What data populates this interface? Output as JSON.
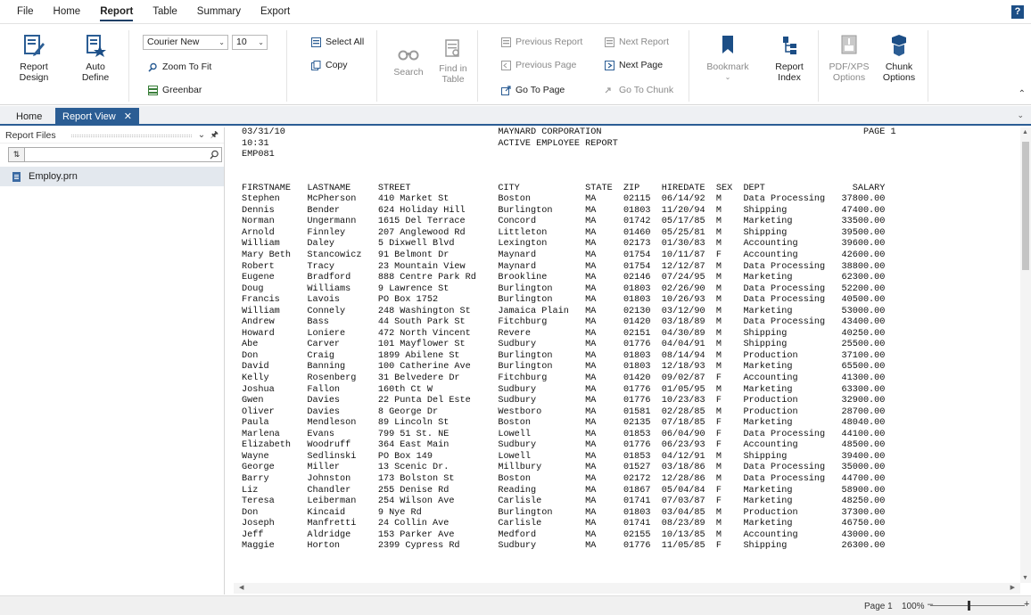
{
  "menu": {
    "items": [
      "File",
      "Home",
      "Report",
      "Table",
      "Summary",
      "Export"
    ],
    "active_index": 2,
    "help_label": "?"
  },
  "ribbon": {
    "report_design": "Report\nDesign",
    "auto_define": "Auto\nDefine",
    "font_name": "Courier New",
    "font_size": "10",
    "zoom_to_fit": "Zoom To Fit",
    "greenbar": "Greenbar",
    "select_all": "Select All",
    "copy": "Copy",
    "search": "Search",
    "find_in_table": "Find in\nTable",
    "previous_report": "Previous Report",
    "next_report": "Next Report",
    "previous_page": "Previous Page",
    "next_page": "Next Page",
    "go_to_page": "Go To Page",
    "go_to_chunk": "Go To Chunk",
    "bookmark": "Bookmark",
    "report_index": "Report\nIndex",
    "pdf_xps_options": "PDF/XPS\nOptions",
    "chunk_options": "Chunk\nOptions"
  },
  "tabs": [
    {
      "label": "Home",
      "active": false
    },
    {
      "label": "Report View",
      "active": true,
      "close": "✕"
    }
  ],
  "left_panel": {
    "title": "Report Files",
    "search_placeholder": "",
    "files": [
      "Employ.prn"
    ]
  },
  "report": {
    "header_lines": [
      {
        "left": "03/31/10",
        "center": "MAYNARD CORPORATION",
        "right": "PAGE 1"
      },
      {
        "left": "10:31",
        "center": "ACTIVE EMPLOYEE REPORT",
        "right": ""
      },
      {
        "left": "EMP081",
        "center": "",
        "right": ""
      }
    ],
    "columns": [
      "FIRSTNAME",
      "LASTNAME",
      "STREET",
      "CITY",
      "STATE",
      "ZIP",
      "HIREDATE",
      "SEX",
      "DEPT",
      "SALARY"
    ],
    "rows": [
      [
        "Stephen",
        "McPherson",
        "410 Market St",
        "Boston",
        "MA",
        "02115",
        "06/14/92",
        "M",
        "Data Processing",
        "37800.00"
      ],
      [
        "Dennis",
        "Bender",
        "624 Holiday Hill",
        "Burlington",
        "MA",
        "01803",
        "11/20/94",
        "M",
        "Shipping",
        "47400.00"
      ],
      [
        "Norman",
        "Ungermann",
        "1615 Del Terrace",
        "Concord",
        "MA",
        "01742",
        "05/17/85",
        "M",
        "Marketing",
        "33500.00"
      ],
      [
        "Arnold",
        "Finnley",
        "207 Anglewood Rd",
        "Littleton",
        "MA",
        "01460",
        "05/25/81",
        "M",
        "Shipping",
        "39500.00"
      ],
      [
        "William",
        "Daley",
        "5 Dixwell Blvd",
        "Lexington",
        "MA",
        "02173",
        "01/30/83",
        "M",
        "Accounting",
        "39600.00"
      ],
      [
        "Mary Beth",
        "Stancowicz",
        "91 Belmont Dr",
        "Maynard",
        "MA",
        "01754",
        "10/11/87",
        "F",
        "Accounting",
        "42600.00"
      ],
      [
        "Robert",
        "Tracy",
        "23 Mountain View",
        "Maynard",
        "MA",
        "01754",
        "12/12/87",
        "M",
        "Data Processing",
        "38800.00"
      ],
      [
        "Eugene",
        "Bradford",
        "888 Centre Park Rd",
        "Brookline",
        "MA",
        "02146",
        "07/24/95",
        "M",
        "Marketing",
        "62300.00"
      ],
      [
        "Doug",
        "Williams",
        "9 Lawrence St",
        "Burlington",
        "MA",
        "01803",
        "02/26/90",
        "M",
        "Data Processing",
        "52200.00"
      ],
      [
        "Francis",
        "Lavois",
        "PO Box 1752",
        "Burlington",
        "MA",
        "01803",
        "10/26/93",
        "M",
        "Data Processing",
        "40500.00"
      ],
      [
        "William",
        "Connely",
        "248 Washington St",
        "Jamaica Plain",
        "MA",
        "02130",
        "03/12/90",
        "M",
        "Marketing",
        "53000.00"
      ],
      [
        "Andrew",
        "Bass",
        "44 South Park St",
        "Fitchburg",
        "MA",
        "01420",
        "03/18/89",
        "M",
        "Data Processing",
        "43400.00"
      ],
      [
        "Howard",
        "Loniere",
        "472 North Vincent",
        "Revere",
        "MA",
        "02151",
        "04/30/89",
        "M",
        "Shipping",
        "40250.00"
      ],
      [
        "Abe",
        "Carver",
        "101 Mayflower St",
        "Sudbury",
        "MA",
        "01776",
        "04/04/91",
        "M",
        "Shipping",
        "25500.00"
      ],
      [
        "Don",
        "Craig",
        "1899 Abilene St",
        "Burlington",
        "MA",
        "01803",
        "08/14/94",
        "M",
        "Production",
        "37100.00"
      ],
      [
        "David",
        "Banning",
        "100 Catherine Ave",
        "Burlington",
        "MA",
        "01803",
        "12/18/93",
        "M",
        "Marketing",
        "65500.00"
      ],
      [
        "Kelly",
        "Rosenberg",
        "31 Belvedere Dr",
        "Fitchburg",
        "MA",
        "01420",
        "09/02/87",
        "F",
        "Accounting",
        "41300.00"
      ],
      [
        "Joshua",
        "Fallon",
        "160th Ct W",
        "Sudbury",
        "MA",
        "01776",
        "01/05/95",
        "M",
        "Marketing",
        "63300.00"
      ],
      [
        "Gwen",
        "Davies",
        "22 Punta Del Este",
        "Sudbury",
        "MA",
        "01776",
        "10/23/83",
        "F",
        "Production",
        "32900.00"
      ],
      [
        "Oliver",
        "Davies",
        "8 George Dr",
        "Westboro",
        "MA",
        "01581",
        "02/28/85",
        "M",
        "Production",
        "28700.00"
      ],
      [
        "Paula",
        "Mendleson",
        "89 Lincoln St",
        "Boston",
        "MA",
        "02135",
        "07/18/85",
        "F",
        "Marketing",
        "48040.00"
      ],
      [
        "Marlena",
        "Evans",
        "799 51 St. NE",
        "Lowell",
        "MA",
        "01853",
        "06/04/90",
        "F",
        "Data Processing",
        "44100.00"
      ],
      [
        "Elizabeth",
        "Woodruff",
        "364 East Main",
        "Sudbury",
        "MA",
        "01776",
        "06/23/93",
        "F",
        "Accounting",
        "48500.00"
      ],
      [
        "Wayne",
        "Sedlinski",
        "PO Box 149",
        "Lowell",
        "MA",
        "01853",
        "04/12/91",
        "M",
        "Shipping",
        "39400.00"
      ],
      [
        "George",
        "Miller",
        "13 Scenic Dr.",
        "Millbury",
        "MA",
        "01527",
        "03/18/86",
        "M",
        "Data Processing",
        "35000.00"
      ],
      [
        "Barry",
        "Johnston",
        "173 Bolston St",
        "Boston",
        "MA",
        "02172",
        "12/28/86",
        "M",
        "Data Processing",
        "44700.00"
      ],
      [
        "Liz",
        "Chandler",
        "255 Denise Rd",
        "Reading",
        "MA",
        "01867",
        "05/04/84",
        "F",
        "Marketing",
        "58900.00"
      ],
      [
        "Teresa",
        "Leiberman",
        "254 Wilson Ave",
        "Carlisle",
        "MA",
        "01741",
        "07/03/87",
        "F",
        "Marketing",
        "48250.00"
      ],
      [
        "Don",
        "Kincaid",
        "9 Nye Rd",
        "Burlington",
        "MA",
        "01803",
        "03/04/85",
        "M",
        "Production",
        "37300.00"
      ],
      [
        "Joseph",
        "Manfretti",
        "24 Collin Ave",
        "Carlisle",
        "MA",
        "01741",
        "08/23/89",
        "M",
        "Marketing",
        "46750.00"
      ],
      [
        "Jeff",
        "Aldridge",
        "153 Parker Ave",
        "Medford",
        "MA",
        "02155",
        "10/13/85",
        "M",
        "Accounting",
        "43000.00"
      ],
      [
        "Maggie",
        "Horton",
        "2399 Cypress Rd",
        "Sudbury",
        "MA",
        "01776",
        "11/05/85",
        "F",
        "Shipping",
        "26300.00"
      ]
    ]
  },
  "status": {
    "page": "Page 1",
    "zoom": "100%",
    "zoom_fraction": 0.4
  },
  "colors": {
    "accent": "#2b5d94",
    "brand_dark": "#1c4e86",
    "selected_file_bg": "#e3e8ee"
  }
}
